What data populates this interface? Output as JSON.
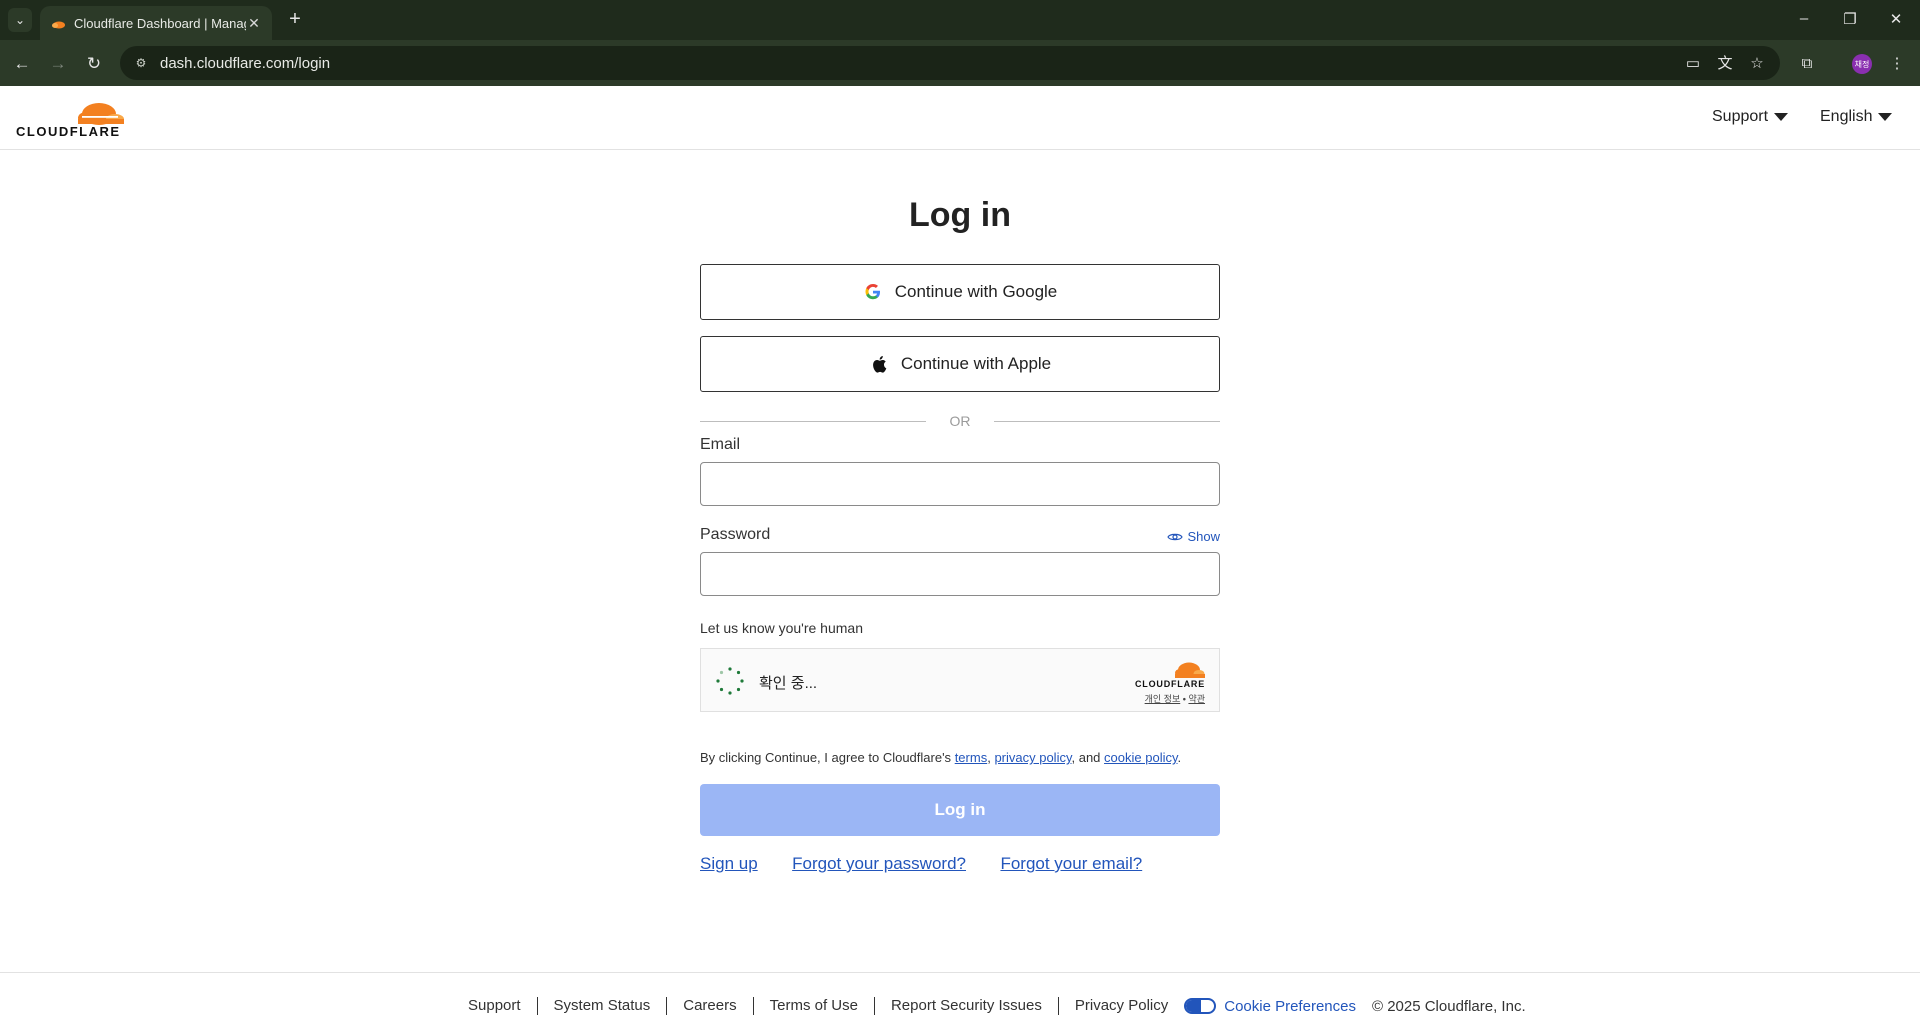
{
  "browser": {
    "tab_title": "Cloudflare Dashboard | Manage",
    "url": "dash.cloudflare.com/login",
    "profile_initials": "채정"
  },
  "header": {
    "logo_text": "CLOUDFLARE",
    "support_label": "Support",
    "language_label": "English"
  },
  "login": {
    "title": "Log in",
    "google_label": "Continue with Google",
    "apple_label": "Continue with Apple",
    "or_text": "OR",
    "email_label": "Email",
    "email_value": "",
    "password_label": "Password",
    "password_value": "",
    "show_label": "Show",
    "human_label": "Let us know you're human",
    "turnstile": {
      "status": "확인 중...",
      "brand": "CLOUDFLARE",
      "privacy": "개인 정보",
      "separator": "•",
      "terms": "약관"
    },
    "agree_prefix": "By clicking Continue, I agree to Cloudflare's",
    "terms_link": "terms",
    "comma": ",",
    "privacy_link": "privacy policy",
    "and_text": ", and",
    "cookie_link": "cookie policy",
    "period": ".",
    "login_button": "Log in",
    "signup_link": "Sign up",
    "forgot_password_link": "Forgot your password?",
    "forgot_email_link": "Forgot your email?"
  },
  "footer": {
    "links": [
      "Support",
      "System Status",
      "Careers",
      "Terms of Use",
      "Report Security Issues",
      "Privacy Policy"
    ],
    "cookie_prefs": "Cookie Preferences",
    "copyright": "© 2025 Cloudflare, Inc."
  },
  "colors": {
    "brand_orange": "#f38020",
    "link_blue": "#2255bb",
    "login_button_disabled": "#9bb6f5"
  }
}
